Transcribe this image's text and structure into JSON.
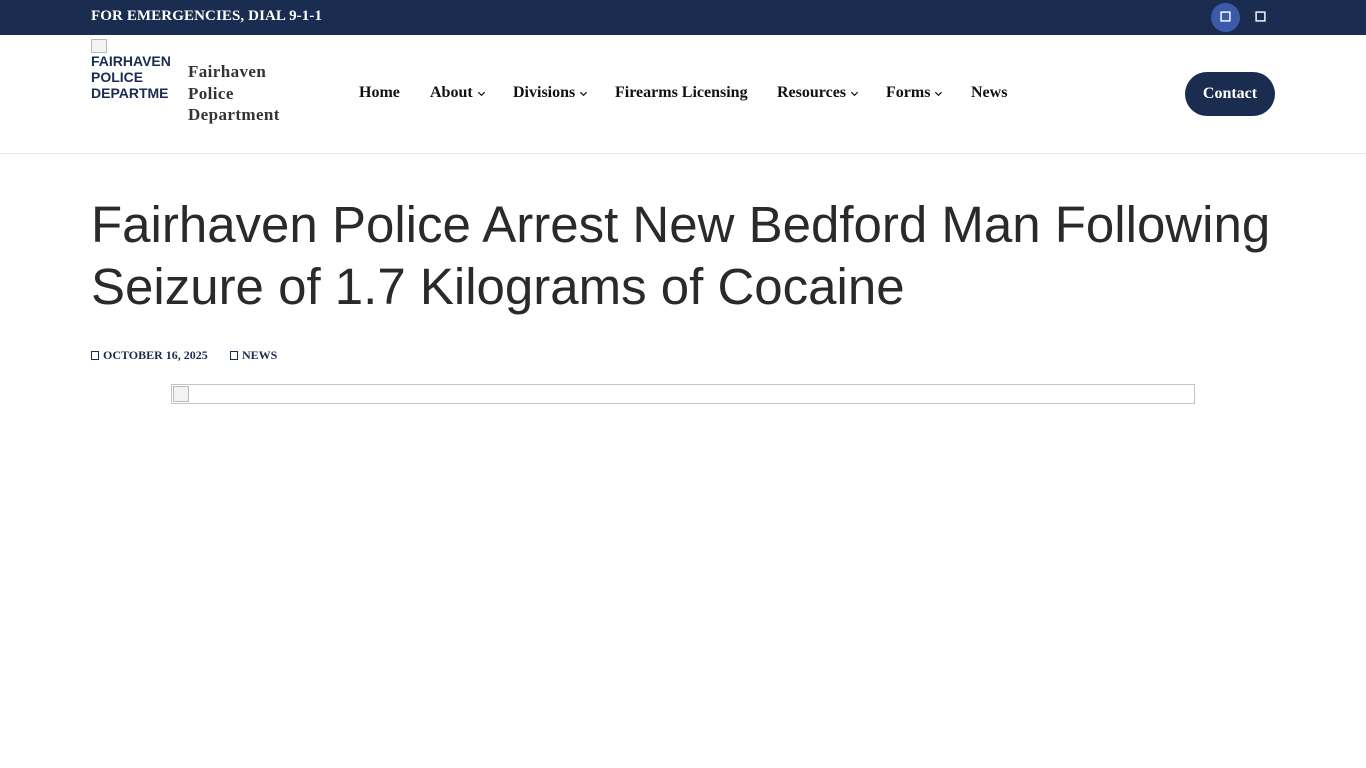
{
  "topbar": {
    "emergency_text": "FOR EMERGENCIES, DIAL 9-1-1",
    "social": [
      {
        "name": "facebook",
        "icon": "facebook-icon"
      },
      {
        "name": "twitter",
        "icon": "twitter-icon"
      }
    ],
    "background_color": "#1a2c50"
  },
  "header": {
    "logo_alt": "FAIRHAVEN\nPOLICE\nDEPARTME",
    "site_name": "Fairhaven Police Department",
    "nav": [
      {
        "label": "Home",
        "has_dropdown": false
      },
      {
        "label": "About",
        "has_dropdown": true
      },
      {
        "label": "Divisions",
        "has_dropdown": true
      },
      {
        "label": "Firearms Licensing",
        "has_dropdown": false
      },
      {
        "label": "Resources",
        "has_dropdown": true
      },
      {
        "label": "Forms",
        "has_dropdown": true
      },
      {
        "label": "News",
        "has_dropdown": false
      }
    ],
    "contact_label": "Contact"
  },
  "article": {
    "title": "Fairhaven Police Arrest New Bedford Man Following Seizure of 1.7 Kilograms of Cocaine",
    "date": "OCTOBER 16, 2025",
    "category": "NEWS"
  },
  "colors": {
    "brand_navy": "#1a2c50",
    "facebook_blue": "#3b5aa8"
  }
}
